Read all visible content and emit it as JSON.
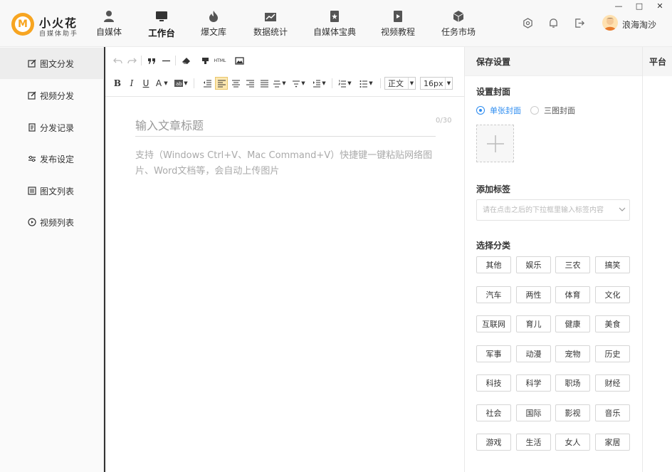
{
  "brand": {
    "logo_letter": "M",
    "name": "小火花",
    "subtitle": "自媒体助手"
  },
  "nav": [
    {
      "label": "自媒体",
      "icon": "person-icon"
    },
    {
      "label": "工作台",
      "icon": "monitor-icon",
      "active": true
    },
    {
      "label": "爆文库",
      "icon": "flame-icon"
    },
    {
      "label": "数据统计",
      "icon": "chart-icon"
    },
    {
      "label": "自媒体宝典",
      "icon": "book-icon"
    },
    {
      "label": "视频教程",
      "icon": "video-icon"
    },
    {
      "label": "任务市场",
      "icon": "cube-icon"
    }
  ],
  "header": {
    "username": "浪海淘沙"
  },
  "window": {
    "minimize": "—",
    "maximize": "□",
    "close": "✕"
  },
  "sidebar": {
    "items": [
      {
        "label": "图文分发",
        "icon": "edit-icon",
        "active": true
      },
      {
        "label": "视频分发",
        "icon": "edit-icon"
      },
      {
        "label": "分发记录",
        "icon": "record-icon"
      },
      {
        "label": "发布设定",
        "icon": "sliders-icon"
      },
      {
        "label": "图文列表",
        "icon": "list-icon"
      },
      {
        "label": "视频列表",
        "icon": "play-icon"
      }
    ]
  },
  "editor": {
    "toolbar": {
      "html_label": "HTML",
      "paragraph_select": "正文",
      "fontsize_select": "16px",
      "bold": "B",
      "italic": "I",
      "underline": "U",
      "font_color": "A"
    },
    "title_placeholder": "输入文章标题",
    "title_count": "0/30",
    "body_placeholder": "支持（Windows Ctrl+V、Mac Command+V）快捷键一键粘贴网络图片、Word文档等，会自动上传图片"
  },
  "settings": {
    "header": "保存设置",
    "cover_title": "设置封面",
    "cover_options": [
      {
        "label": "单张封面",
        "selected": true
      },
      {
        "label": "三图封面",
        "selected": false
      }
    ],
    "tags_title": "添加标签",
    "tags_placeholder": "请在点击之后的下拉框里输入标签内容",
    "category_title": "选择分类",
    "categories": [
      "其他",
      "娱乐",
      "三农",
      "搞笑",
      "汽车",
      "两性",
      "体育",
      "文化",
      "互联网",
      "育儿",
      "健康",
      "美食",
      "军事",
      "动漫",
      "宠物",
      "历史",
      "科技",
      "科学",
      "职场",
      "财经",
      "社会",
      "国际",
      "影视",
      "音乐",
      "游戏",
      "生活",
      "女人",
      "家居"
    ]
  },
  "platform": {
    "header": "平台"
  },
  "colors": {
    "accent": "#2d8cf0",
    "logo": "#f7a521",
    "highlight": "#fce7b0"
  }
}
